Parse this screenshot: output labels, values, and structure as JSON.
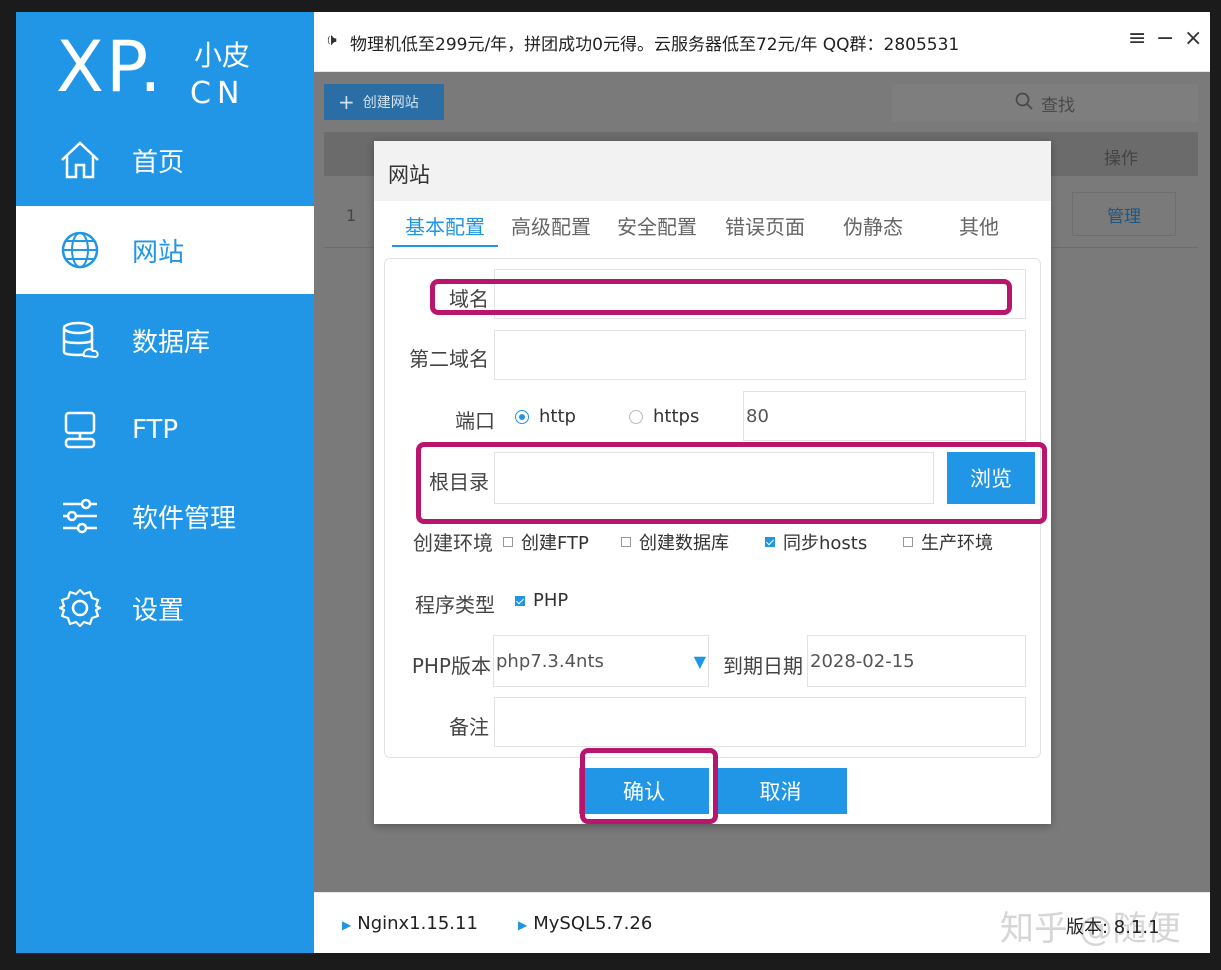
{
  "sidebar": {
    "logo": {
      "main": "XP.",
      "cn_top": "小皮",
      "cn_bottom": "CN"
    },
    "items": [
      {
        "label": "首页",
        "icon": "home-icon"
      },
      {
        "label": "网站",
        "icon": "globe-icon"
      },
      {
        "label": "数据库",
        "icon": "database-icon"
      },
      {
        "label": "FTP",
        "icon": "monitor-icon"
      },
      {
        "label": "软件管理",
        "icon": "sliders-icon"
      },
      {
        "label": "设置",
        "icon": "gear-icon"
      }
    ],
    "active": "网站"
  },
  "topbar": {
    "notice": "物理机低至299元/年，拼团成功0元得。云服务器低至72元/年 QQ群：2805531",
    "notice_icon": "speaker-icon",
    "menu_icon": "≡",
    "minimize_icon": "−",
    "close_icon": "×"
  },
  "toolbar": {
    "create_label": "创建网站",
    "search_placeholder": "查找"
  },
  "table": {
    "header_operation": "操作",
    "rows": [
      {
        "index": "1",
        "action": "管理"
      }
    ]
  },
  "dialog": {
    "title": "网站",
    "tabs": [
      "基本配置",
      "高级配置",
      "安全配置",
      "错误页面",
      "伪静态",
      "其他"
    ],
    "active_tab": "基本配置",
    "fields": {
      "domain_label": "域名",
      "domain_value": "",
      "second_domain_label": "第二域名",
      "second_domain_value": "",
      "port_label": "端口",
      "port_protocols": [
        "http",
        "https"
      ],
      "port_selected": "http",
      "port_value": "80",
      "root_label": "根目录",
      "root_value": "",
      "browse_label": "浏览",
      "env_label": "创建环境",
      "env_options": [
        {
          "label": "创建FTP",
          "checked": false
        },
        {
          "label": "创建数据库",
          "checked": false
        },
        {
          "label": "同步hosts",
          "checked": true
        },
        {
          "label": "生产环境",
          "checked": false
        }
      ],
      "program_type_label": "程序类型",
      "program_type_option": {
        "label": "PHP",
        "checked": true
      },
      "php_version_label": "PHP版本",
      "php_version_value": "php7.3.4nts",
      "expire_label": "到期日期",
      "expire_value": "2028-02-15",
      "note_label": "备注",
      "note_value": ""
    },
    "confirm_label": "确认",
    "cancel_label": "取消"
  },
  "footer": {
    "services": [
      "Nginx1.15.11",
      "MySQL5.7.26"
    ],
    "version_label": "版本: 8.1.1",
    "watermark": "知乎 @随便"
  },
  "colors": {
    "primary": "#2196e6",
    "highlight": "#b8166c"
  }
}
